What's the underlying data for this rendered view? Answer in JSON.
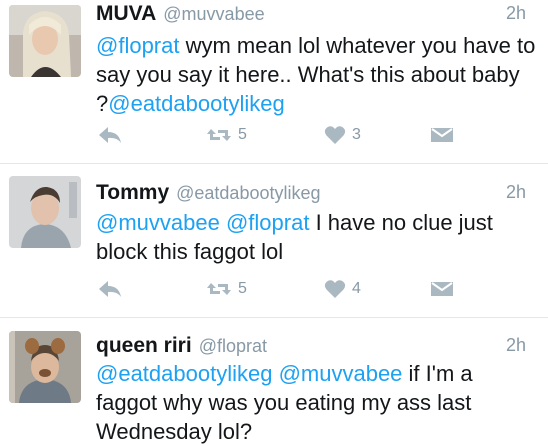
{
  "tweets": [
    {
      "display_name": "MUVA",
      "handle": "@muvvabee",
      "time": "2h",
      "body": [
        {
          "mention": "@floprat"
        },
        {
          "text": " wym mean lol whatever you have to say you say it here.. What's this about baby ?"
        },
        {
          "mention": "@eatdabootylikeg"
        }
      ],
      "retweets": "5",
      "likes": "3"
    },
    {
      "display_name": "Tommy",
      "handle": "@eatdabootylikeg",
      "time": "2h",
      "body": [
        {
          "mention": "@muvvabee"
        },
        {
          "text": " "
        },
        {
          "mention": "@floprat"
        },
        {
          "text": " I have no clue just block this faggot lol"
        }
      ],
      "retweets": "5",
      "likes": "4"
    },
    {
      "display_name": "queen riri",
      "handle": "@floprat",
      "time": "2h",
      "body": [
        {
          "mention": "@eatdabootylikeg"
        },
        {
          "text": " "
        },
        {
          "mention": "@muvvabee"
        },
        {
          "text": " if I'm a faggot why was you eating my ass last Wednesday lol?"
        }
      ]
    }
  ],
  "colors": {
    "mention": "#1da1f2",
    "meta_gray": "#8899a6",
    "icon_gray": "#aab8c2",
    "divider": "#e1e8ed"
  },
  "icons": [
    "reply-icon",
    "retweet-icon",
    "like-icon",
    "direct-message-icon"
  ]
}
